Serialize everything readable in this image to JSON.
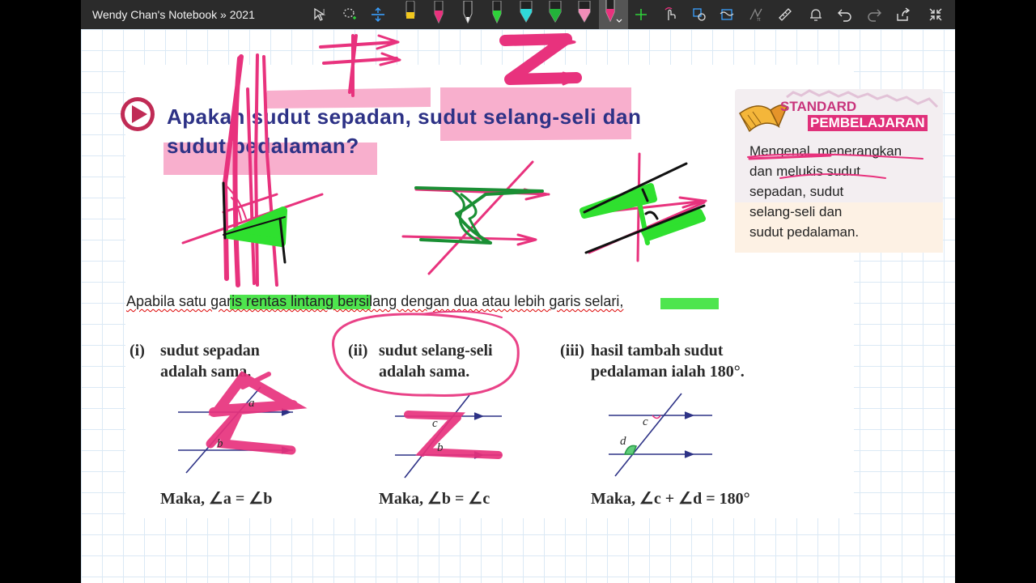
{
  "window": {
    "title": "Wendy Chan's Notebook » 2021"
  },
  "toolbar": {
    "icons": [
      "select-text-icon",
      "lasso-icon",
      "add-space-icon",
      "highlighter-yellow",
      "pen-pink",
      "pen-black",
      "pen-green",
      "pen-cyan",
      "pen-green-2",
      "pen-pink-2",
      "pen-dark-selected",
      "add-pen-icon",
      "touch-draw-icon",
      "shapes-icon",
      "ink-to-shape-icon",
      "ink-to-math-icon",
      "ruler-icon",
      "notification-icon",
      "undo-icon",
      "redo-icon",
      "share-icon",
      "fullscreen-icon"
    ],
    "colors": {
      "yellow": "#f2c81e",
      "pink": "#e8327d",
      "black": "#111111",
      "green": "#2fd23a",
      "cyan": "#2fd8d8",
      "green2": "#23b33a",
      "pink2": "#f08db8"
    }
  },
  "page": {
    "heading_line1": "Apakah sudut sepadan, sudut selang-seli dan",
    "heading_line2": "sudut pedalaman?",
    "standard": {
      "title1": "STANDARD",
      "title2": "PEMBELAJARAN",
      "lines": [
        "Mengenal, menerangkan",
        "dan melukis sudut",
        "sepadan, sudut",
        "selang-seli dan",
        "sudut pedalaman."
      ]
    },
    "statement": "Apabila satu garis rentas lintang bersilang dengan dua atau lebih garis selari,",
    "props": [
      {
        "num": "(i)",
        "line1": "sudut sepadan",
        "line2": "adalah sama.",
        "maka": "Maka, ∠a = ∠b",
        "lbl_a": "a",
        "lbl_b": "b"
      },
      {
        "num": "(ii)",
        "line1": "sudut selang-seli",
        "line2": "adalah sama.",
        "maka": "Maka, ∠b = ∠c",
        "lbl_a": "c",
        "lbl_b": "b"
      },
      {
        "num": "(iii)",
        "line1": "hasil tambah sudut",
        "line2": "pedalaman ialah 180°.",
        "maka": "Maka, ∠c + ∠d = 180°",
        "lbl_a": "c",
        "lbl_b": "d"
      }
    ]
  },
  "ink": {
    "pink": "#e8327d",
    "green": "#2fe02f",
    "darkgreen": "#1a8f34",
    "navy": "#2d3286",
    "highlight_pink": "#f7a6c8"
  }
}
